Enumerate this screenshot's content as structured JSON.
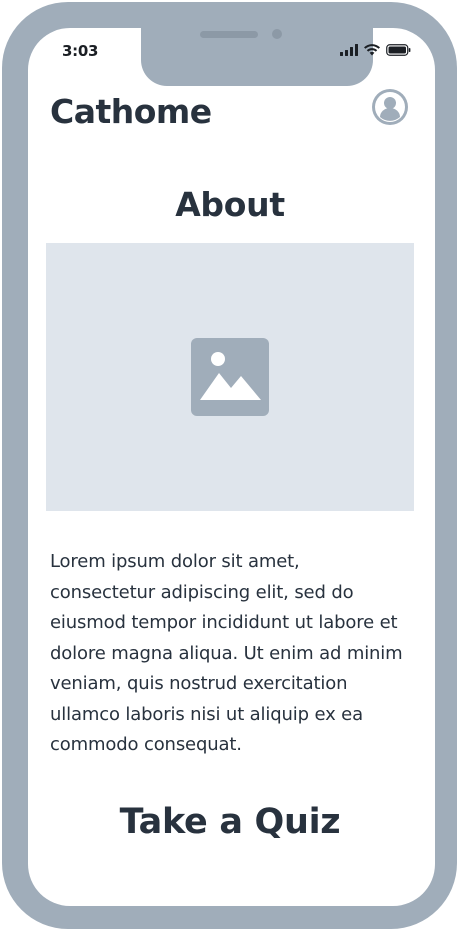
{
  "status_bar": {
    "time": "3:03",
    "icons": [
      "cellular-signal-icon",
      "wifi-icon",
      "battery-icon"
    ]
  },
  "header": {
    "app_title": "Cathome",
    "avatar_icon": "user-avatar-icon"
  },
  "about": {
    "heading": "About",
    "image_icon": "image-placeholder-icon",
    "body": "Lorem ipsum dolor sit amet, consectetur adipiscing elit, sed do eiusmod tempor incididunt ut labore et dolore magna aliqua. Ut enim ad minim veniam, quis nostrud exercitation ullamco laboris nisi ut aliquip ex ea commodo consequat."
  },
  "quiz": {
    "heading": "Take a Quiz"
  },
  "colors": {
    "frame": "#a0adba",
    "text": "#28323e",
    "image_placeholder_bg": "#dfe5ec",
    "image_icon": "#a0adba"
  }
}
